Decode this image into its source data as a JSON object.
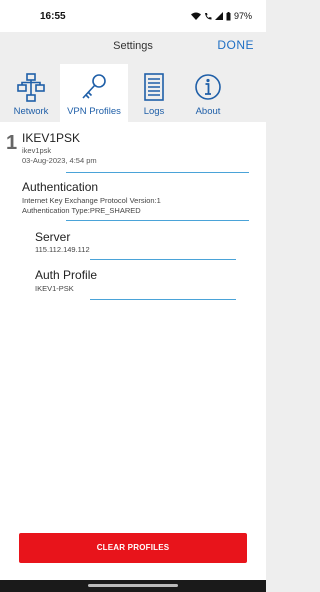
{
  "status": {
    "time": "16:55",
    "battery": "97%"
  },
  "header": {
    "title": "Settings",
    "done_label": "DONE"
  },
  "tabs": [
    {
      "label": "Network",
      "icon": "network-icon"
    },
    {
      "label": "VPN Profiles",
      "icon": "key-icon"
    },
    {
      "label": "Logs",
      "icon": "logs-icon"
    },
    {
      "label": "About",
      "icon": "info-icon"
    }
  ],
  "profile": {
    "number": "1",
    "name": "IKEV1PSK",
    "subname": "ikev1psk",
    "date": "03-Aug-2023, 4:54 pm",
    "auth": {
      "heading": "Authentication",
      "protocol": "Internet Key Exchange Protocol Version:1",
      "type": "Authentication Type:PRE_SHARED"
    },
    "server": {
      "heading": "Server",
      "value": "115.112.149.112"
    },
    "auth_profile": {
      "heading": "Auth Profile",
      "value": "IKEV1-PSK"
    }
  },
  "clear_button": "CLEAR PROFILES",
  "colors": {
    "accent": "#1f6fc4",
    "button": "#e8141b",
    "divider": "#4aa3d8"
  }
}
